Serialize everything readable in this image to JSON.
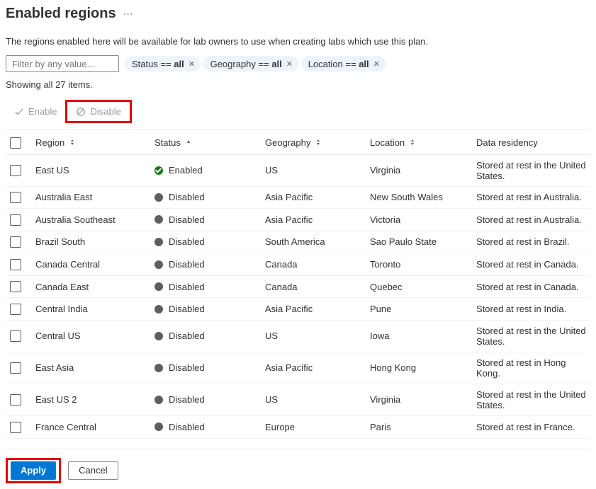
{
  "header": {
    "title": "Enabled regions"
  },
  "description": "The regions enabled here will be available for lab owners to use when creating labs which use this plan.",
  "filter": {
    "placeholder": "Filter by any value..."
  },
  "chips": [
    {
      "key": "Status",
      "op": "==",
      "value": "all"
    },
    {
      "key": "Geography",
      "op": "==",
      "value": "all"
    },
    {
      "key": "Location",
      "op": "==",
      "value": "all"
    }
  ],
  "count_text": "Showing all 27 items.",
  "toolbar": {
    "enable": "Enable",
    "disable": "Disable"
  },
  "columns": {
    "region": "Region",
    "status": "Status",
    "geography": "Geography",
    "location": "Location",
    "residency": "Data residency"
  },
  "status_labels": {
    "enabled": "Enabled",
    "disabled": "Disabled"
  },
  "rows": [
    {
      "region": "East US",
      "status": "enabled",
      "geography": "US",
      "location": "Virginia",
      "residency": "Stored at rest in the United States."
    },
    {
      "region": "Australia East",
      "status": "disabled",
      "geography": "Asia Pacific",
      "location": "New South Wales",
      "residency": "Stored at rest in Australia."
    },
    {
      "region": "Australia Southeast",
      "status": "disabled",
      "geography": "Asia Pacific",
      "location": "Victoria",
      "residency": "Stored at rest in Australia."
    },
    {
      "region": "Brazil South",
      "status": "disabled",
      "geography": "South America",
      "location": "Sao Paulo State",
      "residency": "Stored at rest in Brazil."
    },
    {
      "region": "Canada Central",
      "status": "disabled",
      "geography": "Canada",
      "location": "Toronto",
      "residency": "Stored at rest in Canada."
    },
    {
      "region": "Canada East",
      "status": "disabled",
      "geography": "Canada",
      "location": "Quebec",
      "residency": "Stored at rest in Canada."
    },
    {
      "region": "Central India",
      "status": "disabled",
      "geography": "Asia Pacific",
      "location": "Pune",
      "residency": "Stored at rest in India."
    },
    {
      "region": "Central US",
      "status": "disabled",
      "geography": "US",
      "location": "Iowa",
      "residency": "Stored at rest in the United States."
    },
    {
      "region": "East Asia",
      "status": "disabled",
      "geography": "Asia Pacific",
      "location": "Hong Kong",
      "residency": "Stored at rest in Hong Kong."
    },
    {
      "region": "East US 2",
      "status": "disabled",
      "geography": "US",
      "location": "Virginia",
      "residency": "Stored at rest in the United States."
    },
    {
      "region": "France Central",
      "status": "disabled",
      "geography": "Europe",
      "location": "Paris",
      "residency": "Stored at rest in France."
    }
  ],
  "footer": {
    "apply": "Apply",
    "cancel": "Cancel"
  }
}
